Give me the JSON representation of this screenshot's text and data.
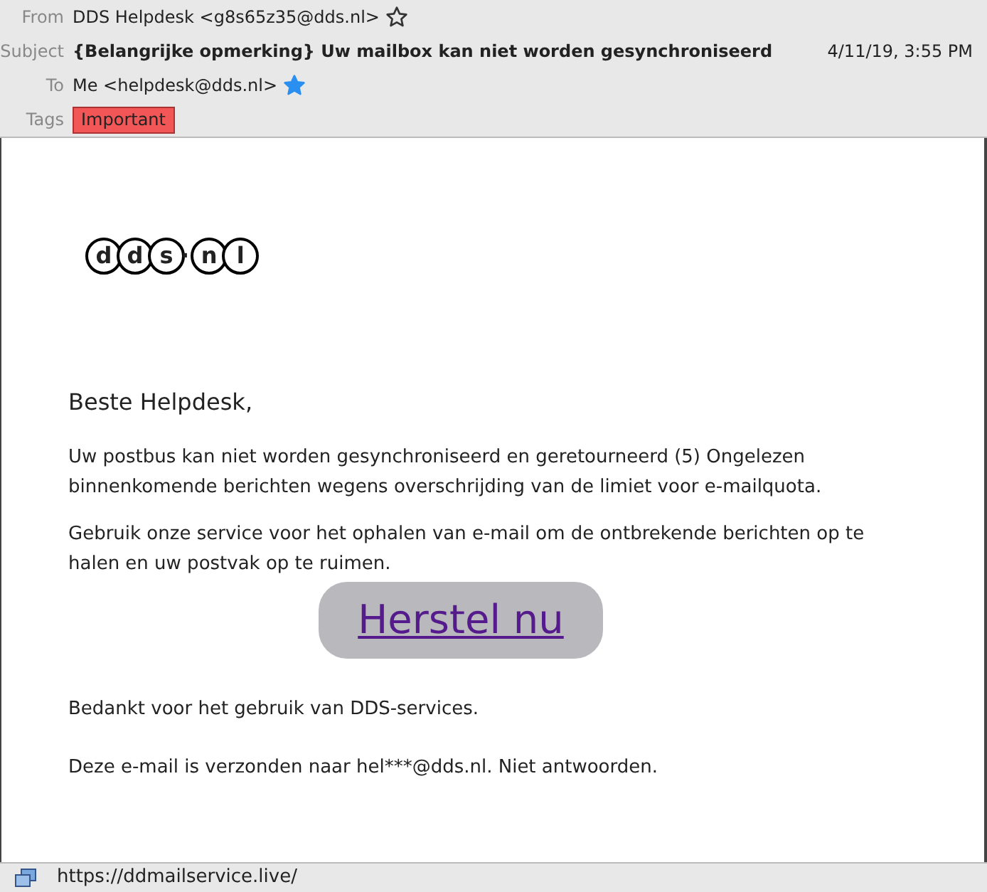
{
  "header": {
    "fields": [
      {
        "label": "From",
        "value": "DDS Helpdesk <g8s65z35@dds.nl>",
        "kind": "address",
        "starred": false
      },
      {
        "label": "Subject",
        "value": "{Belangrijke opmerking} Uw mailbox kan niet worden gesynchroniseerd",
        "kind": "subject",
        "date": "4/11/19, 3:55 PM"
      },
      {
        "label": "To",
        "value": "Me <helpdesk@dds.nl>",
        "kind": "address",
        "starred": true
      },
      {
        "label": "Tags",
        "kind": "tags",
        "tags": [
          {
            "text": "Important",
            "color": "#f25656"
          }
        ]
      }
    ]
  },
  "message": {
    "logo": [
      "d",
      "d",
      "s",
      "·",
      "n",
      "l"
    ],
    "greeting": "Beste Helpdesk,",
    "paragraphs": [
      "Uw postbus kan niet worden gesynchroniseerd en geretourneerd (5) Ongelezen binnenkomende berichten wegens overschrijding van de limiet voor e-mailquota.",
      "Gebruik onze service voor het ophalen van e-mail om de ontbrekende berichten op te halen en uw postvak op te ruimen."
    ],
    "button": "Herstel nu",
    "closing": [
      "Bedankt voor het gebruik van DDS-services.",
      "Deze e-mail is verzonden naar hel***@dds.nl. Niet antwoorden."
    ]
  },
  "status_bar": {
    "url": "https://ddmailservice.live/"
  }
}
